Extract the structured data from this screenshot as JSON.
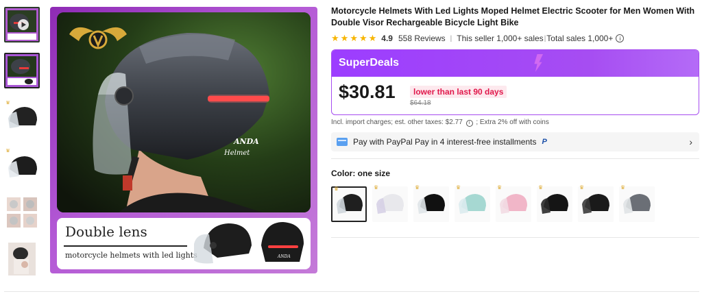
{
  "product": {
    "title": "Motorcycle Helmets With Led Lights Moped Helmet Electric Scooter for Men Women With Double Visor Rechargeable Bicycle Light Bike",
    "rating": "4.9",
    "reviews": "558 Reviews",
    "seller_sales": "This seller 1,000+ sales",
    "total_sales": "Total sales 1,000+"
  },
  "deals": {
    "label": "SuperDeals",
    "price": "$30.81",
    "price_note": "lower than last 90 days",
    "old_price": "$64.18",
    "accent_color": "#a54bf0",
    "price_note_color": "#e0184b"
  },
  "taxes": {
    "text": "Incl. import charges; est. other taxes: $2.77",
    "extra": "; Extra 2% off with coins"
  },
  "paypal": {
    "text": "Pay with PayPal Pay in 4 interest-free installments"
  },
  "color": {
    "label": "Color: ",
    "value": "one size"
  },
  "main_image": {
    "helmet_brand_1": "ANDA",
    "helmet_brand_2": "Helmet",
    "panel_title": "Double lens",
    "panel_subtitle": "motorcycle helmets with led lights"
  },
  "swatch_colors": [
    "black-matte",
    "white-pink",
    "black-gloss",
    "mint",
    "pink",
    "black-gold",
    "black",
    "grey-white"
  ],
  "icons": {
    "star": "star-icon",
    "info": "info-icon",
    "card": "card-icon",
    "paypal": "paypal-icon",
    "chevron": "chevron-right-icon",
    "play": "play-icon"
  }
}
